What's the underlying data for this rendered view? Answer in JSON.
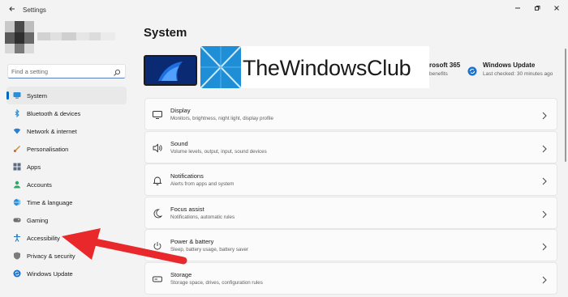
{
  "window": {
    "title": "Settings",
    "back_icon": "back-arrow-icon",
    "controls": [
      "minimize-icon",
      "restore-icon",
      "close-icon"
    ]
  },
  "search": {
    "placeholder": "Find a setting",
    "icon": "search-icon"
  },
  "sidebar": {
    "items": [
      {
        "label": "System",
        "icon": "system-monitor-icon",
        "selected": true
      },
      {
        "label": "Bluetooth & devices",
        "icon": "bluetooth-icon"
      },
      {
        "label": "Network & internet",
        "icon": "wifi-icon"
      },
      {
        "label": "Personalisation",
        "icon": "brush-icon"
      },
      {
        "label": "Apps",
        "icon": "apps-icon"
      },
      {
        "label": "Accounts",
        "icon": "person-icon"
      },
      {
        "label": "Time & language",
        "icon": "globe-clock-icon"
      },
      {
        "label": "Gaming",
        "icon": "gamepad-icon"
      },
      {
        "label": "Accessibility",
        "icon": "accessibility-icon"
      },
      {
        "label": "Privacy & security",
        "icon": "shield-icon"
      },
      {
        "label": "Windows Update",
        "icon": "update-icon"
      }
    ]
  },
  "main": {
    "title": "System",
    "watermark": "TheWindowsClub",
    "ms365": {
      "title": "rosoft 365",
      "subtitle": "benefits"
    },
    "windows_update": {
      "title": "Windows Update",
      "subtitle": "Last checked: 30 minutes ago"
    },
    "cards": [
      {
        "title": "Display",
        "subtitle": "Monitors, brightness, night light, display profile",
        "icon": "display-icon"
      },
      {
        "title": "Sound",
        "subtitle": "Volume levels, output, input, sound devices",
        "icon": "speaker-icon"
      },
      {
        "title": "Notifications",
        "subtitle": "Alerts from apps and system",
        "icon": "bell-icon"
      },
      {
        "title": "Focus assist",
        "subtitle": "Notifications, automatic rules",
        "icon": "moon-icon"
      },
      {
        "title": "Power & battery",
        "subtitle": "Sleep, battery usage, battery saver",
        "icon": "power-icon"
      },
      {
        "title": "Storage",
        "subtitle": "Storage space, drives, configuration rules",
        "icon": "storage-icon"
      }
    ]
  },
  "colors": {
    "accent": "#0067c0",
    "annotation_arrow": "#e8282b",
    "background": "#f3f3f3"
  }
}
